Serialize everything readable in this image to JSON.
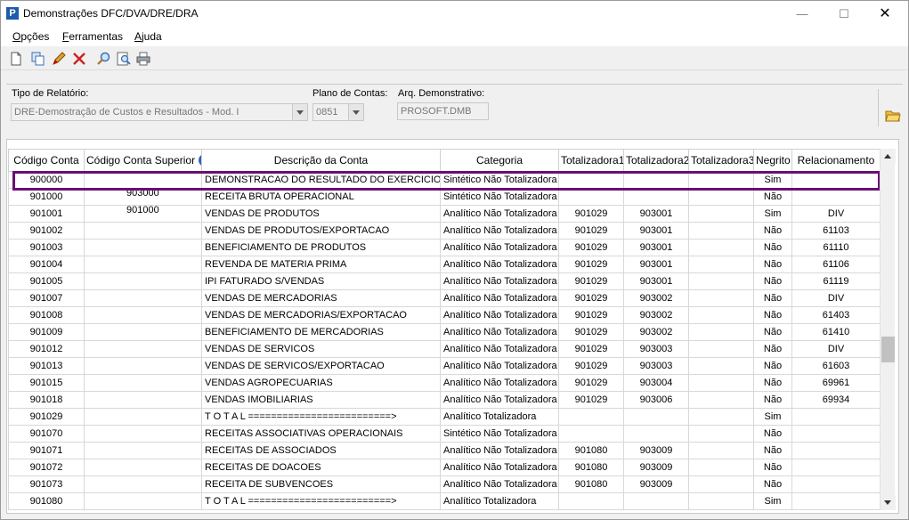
{
  "window": {
    "title": "Demonstrações DFC/DVA/DRE/DRA"
  },
  "menu": [
    {
      "label": "Opções",
      "u": "O",
      "rest": "pções"
    },
    {
      "label": "Ferramentas",
      "u": "F",
      "rest": "erramentas"
    },
    {
      "label": "Ajuda",
      "u": "A",
      "rest": "juda"
    }
  ],
  "toolbar": [
    "new-doc-icon",
    "copy-icon",
    "edit-pencil-icon",
    "delete-icon",
    "search-icon",
    "find-icon",
    "print-icon"
  ],
  "filters": {
    "tipo_label": "Tipo de Relatório:",
    "tipo_value": "DRE-Demostração de Custos e Resultados - Mod. I",
    "plano_label": "Plano de Contas:",
    "plano_value": "0851",
    "arq_label": "Arq. Demonstrativo:",
    "arq_value": "PROSOFT.DMB"
  },
  "table": {
    "headers": [
      "Código Conta",
      "Código Conta Superior",
      "Descrição da Conta",
      "Categoria",
      "Totalizadora1",
      "Totalizadora2",
      "Totalizadora3",
      "Negrito",
      "Relacionamento"
    ],
    "rows": [
      [
        "900000",
        "",
        "DEMONSTRACAO DO RESULTADO DO EXERCICIO",
        "Sintético Não Totalizadora",
        "",
        "",
        "",
        "Sim",
        ""
      ],
      [
        "901000",
        "903000",
        "RECEITA BRUTA OPERACIONAL",
        "Sintético Não Totalizadora",
        "",
        "",
        "",
        "Não",
        ""
      ],
      [
        "901001",
        "901000",
        "VENDAS DE PRODUTOS",
        "Analítico Não Totalizadora",
        "901029",
        "903001",
        "",
        "Sim",
        "DIV"
      ],
      [
        "901002",
        "",
        "VENDAS DE PRODUTOS/EXPORTACAO",
        "Analítico Não Totalizadora",
        "901029",
        "903001",
        "",
        "Não",
        "61103"
      ],
      [
        "901003",
        "",
        "BENEFICIAMENTO DE PRODUTOS",
        "Analítico Não Totalizadora",
        "901029",
        "903001",
        "",
        "Não",
        "61110"
      ],
      [
        "901004",
        "",
        "REVENDA DE MATERIA PRIMA",
        "Analítico Não Totalizadora",
        "901029",
        "903001",
        "",
        "Não",
        "61106"
      ],
      [
        "901005",
        "",
        "IPI FATURADO S/VENDAS",
        "Analítico Não Totalizadora",
        "901029",
        "903001",
        "",
        "Não",
        "61119"
      ],
      [
        "901007",
        "",
        "VENDAS DE MERCADORIAS",
        "Analítico Não Totalizadora",
        "901029",
        "903002",
        "",
        "Não",
        "DIV"
      ],
      [
        "901008",
        "",
        "VENDAS DE MERCADORIAS/EXPORTACAO",
        "Analítico Não Totalizadora",
        "901029",
        "903002",
        "",
        "Não",
        "61403"
      ],
      [
        "901009",
        "",
        "BENEFICIAMENTO DE MERCADORIAS",
        "Analítico Não Totalizadora",
        "901029",
        "903002",
        "",
        "Não",
        "61410"
      ],
      [
        "901012",
        "",
        "VENDAS DE SERVICOS",
        "Analítico Não Totalizadora",
        "901029",
        "903003",
        "",
        "Não",
        "DIV"
      ],
      [
        "901013",
        "",
        "VENDAS DE SERVICOS/EXPORTACAO",
        "Analítico Não Totalizadora",
        "901029",
        "903003",
        "",
        "Não",
        "61603"
      ],
      [
        "901015",
        "",
        "VENDAS AGROPECUARIAS",
        "Analítico Não Totalizadora",
        "901029",
        "903004",
        "",
        "Não",
        "69961"
      ],
      [
        "901018",
        "",
        "VENDAS IMOBILIARIAS",
        "Analítico Não Totalizadora",
        "901029",
        "903006",
        "",
        "Não",
        "69934"
      ],
      [
        "901029",
        "",
        "T O T A L =========================>",
        "Analítico Totalizadora",
        "",
        "",
        "",
        "Sim",
        ""
      ],
      [
        "901070",
        "",
        "RECEITAS ASSOCIATIVAS OPERACIONAIS",
        "Sintético Não Totalizadora",
        "",
        "",
        "",
        "Não",
        ""
      ],
      [
        "901071",
        "",
        "RECEITAS DE ASSOCIADOS",
        "Analítico Não Totalizadora",
        "901080",
        "903009",
        "",
        "Não",
        ""
      ],
      [
        "901072",
        "",
        "RECEITAS DE DOACOES",
        "Analítico Não Totalizadora",
        "901080",
        "903009",
        "",
        "Não",
        ""
      ],
      [
        "901073",
        "",
        "RECEITA DE SUBVENCOES",
        "Analítico Não Totalizadora",
        "901080",
        "903009",
        "",
        "Não",
        ""
      ],
      [
        "901080",
        "",
        "T O T A L =========================>",
        "Analítico Totalizadora",
        "",
        "",
        "",
        "Sim",
        ""
      ]
    ]
  },
  "colors": {
    "highlight": "#6a0f74",
    "app_icon": "#1e5ca8",
    "info_icon": "#2a64c8"
  }
}
